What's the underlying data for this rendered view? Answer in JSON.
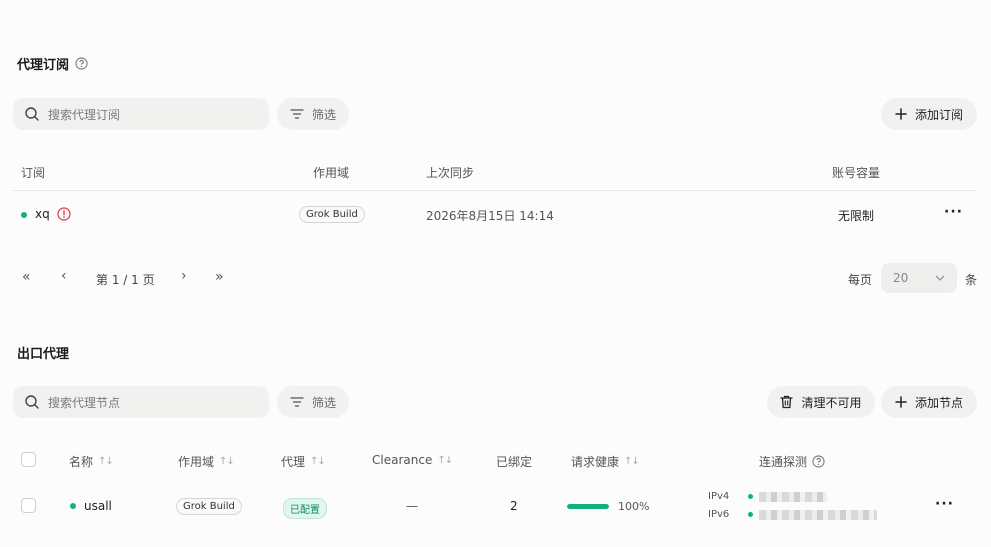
{
  "subscriptions": {
    "title": "代理订阅",
    "search_placeholder": "搜索代理订阅",
    "filter_label": "筛选",
    "add_label": "添加订阅",
    "columns": {
      "name": "订阅",
      "scope": "作用域",
      "last_sync": "上次同步",
      "capacity": "账号容量"
    },
    "rows": [
      {
        "name": "xq",
        "scope": "Grok Build",
        "last_sync": "2026年8月15日 14:14",
        "capacity": "无限制",
        "more": "···"
      }
    ],
    "pager": {
      "first": "«",
      "prev": "‹",
      "page_text": "第 1 / 1 页",
      "next": "›",
      "last": "»",
      "per_page_label": "每页",
      "per_page_value": "20",
      "unit": "条"
    }
  },
  "exit_proxies": {
    "title": "出口代理",
    "search_placeholder": "搜索代理节点",
    "filter_label": "筛选",
    "clean_label": "清理不可用",
    "add_label": "添加节点",
    "columns": {
      "name": "名称",
      "scope": "作用域",
      "proxy": "代理",
      "clearance": "Clearance",
      "bound": "已绑定",
      "health": "请求健康",
      "probe": "连通探测"
    },
    "sort_glyph": "↑↓",
    "rows": [
      {
        "name": "usall",
        "scope": "Grok Build",
        "proxy": "已配置",
        "clearance": "—",
        "bound": "2",
        "health_percent": 100,
        "health_text": "100%",
        "ipv4_label": "IPv4",
        "ipv6_label": "IPv6",
        "more": "···"
      }
    ]
  },
  "colors": {
    "accent_green": "#14b07a",
    "alert_red": "#d9363e"
  }
}
